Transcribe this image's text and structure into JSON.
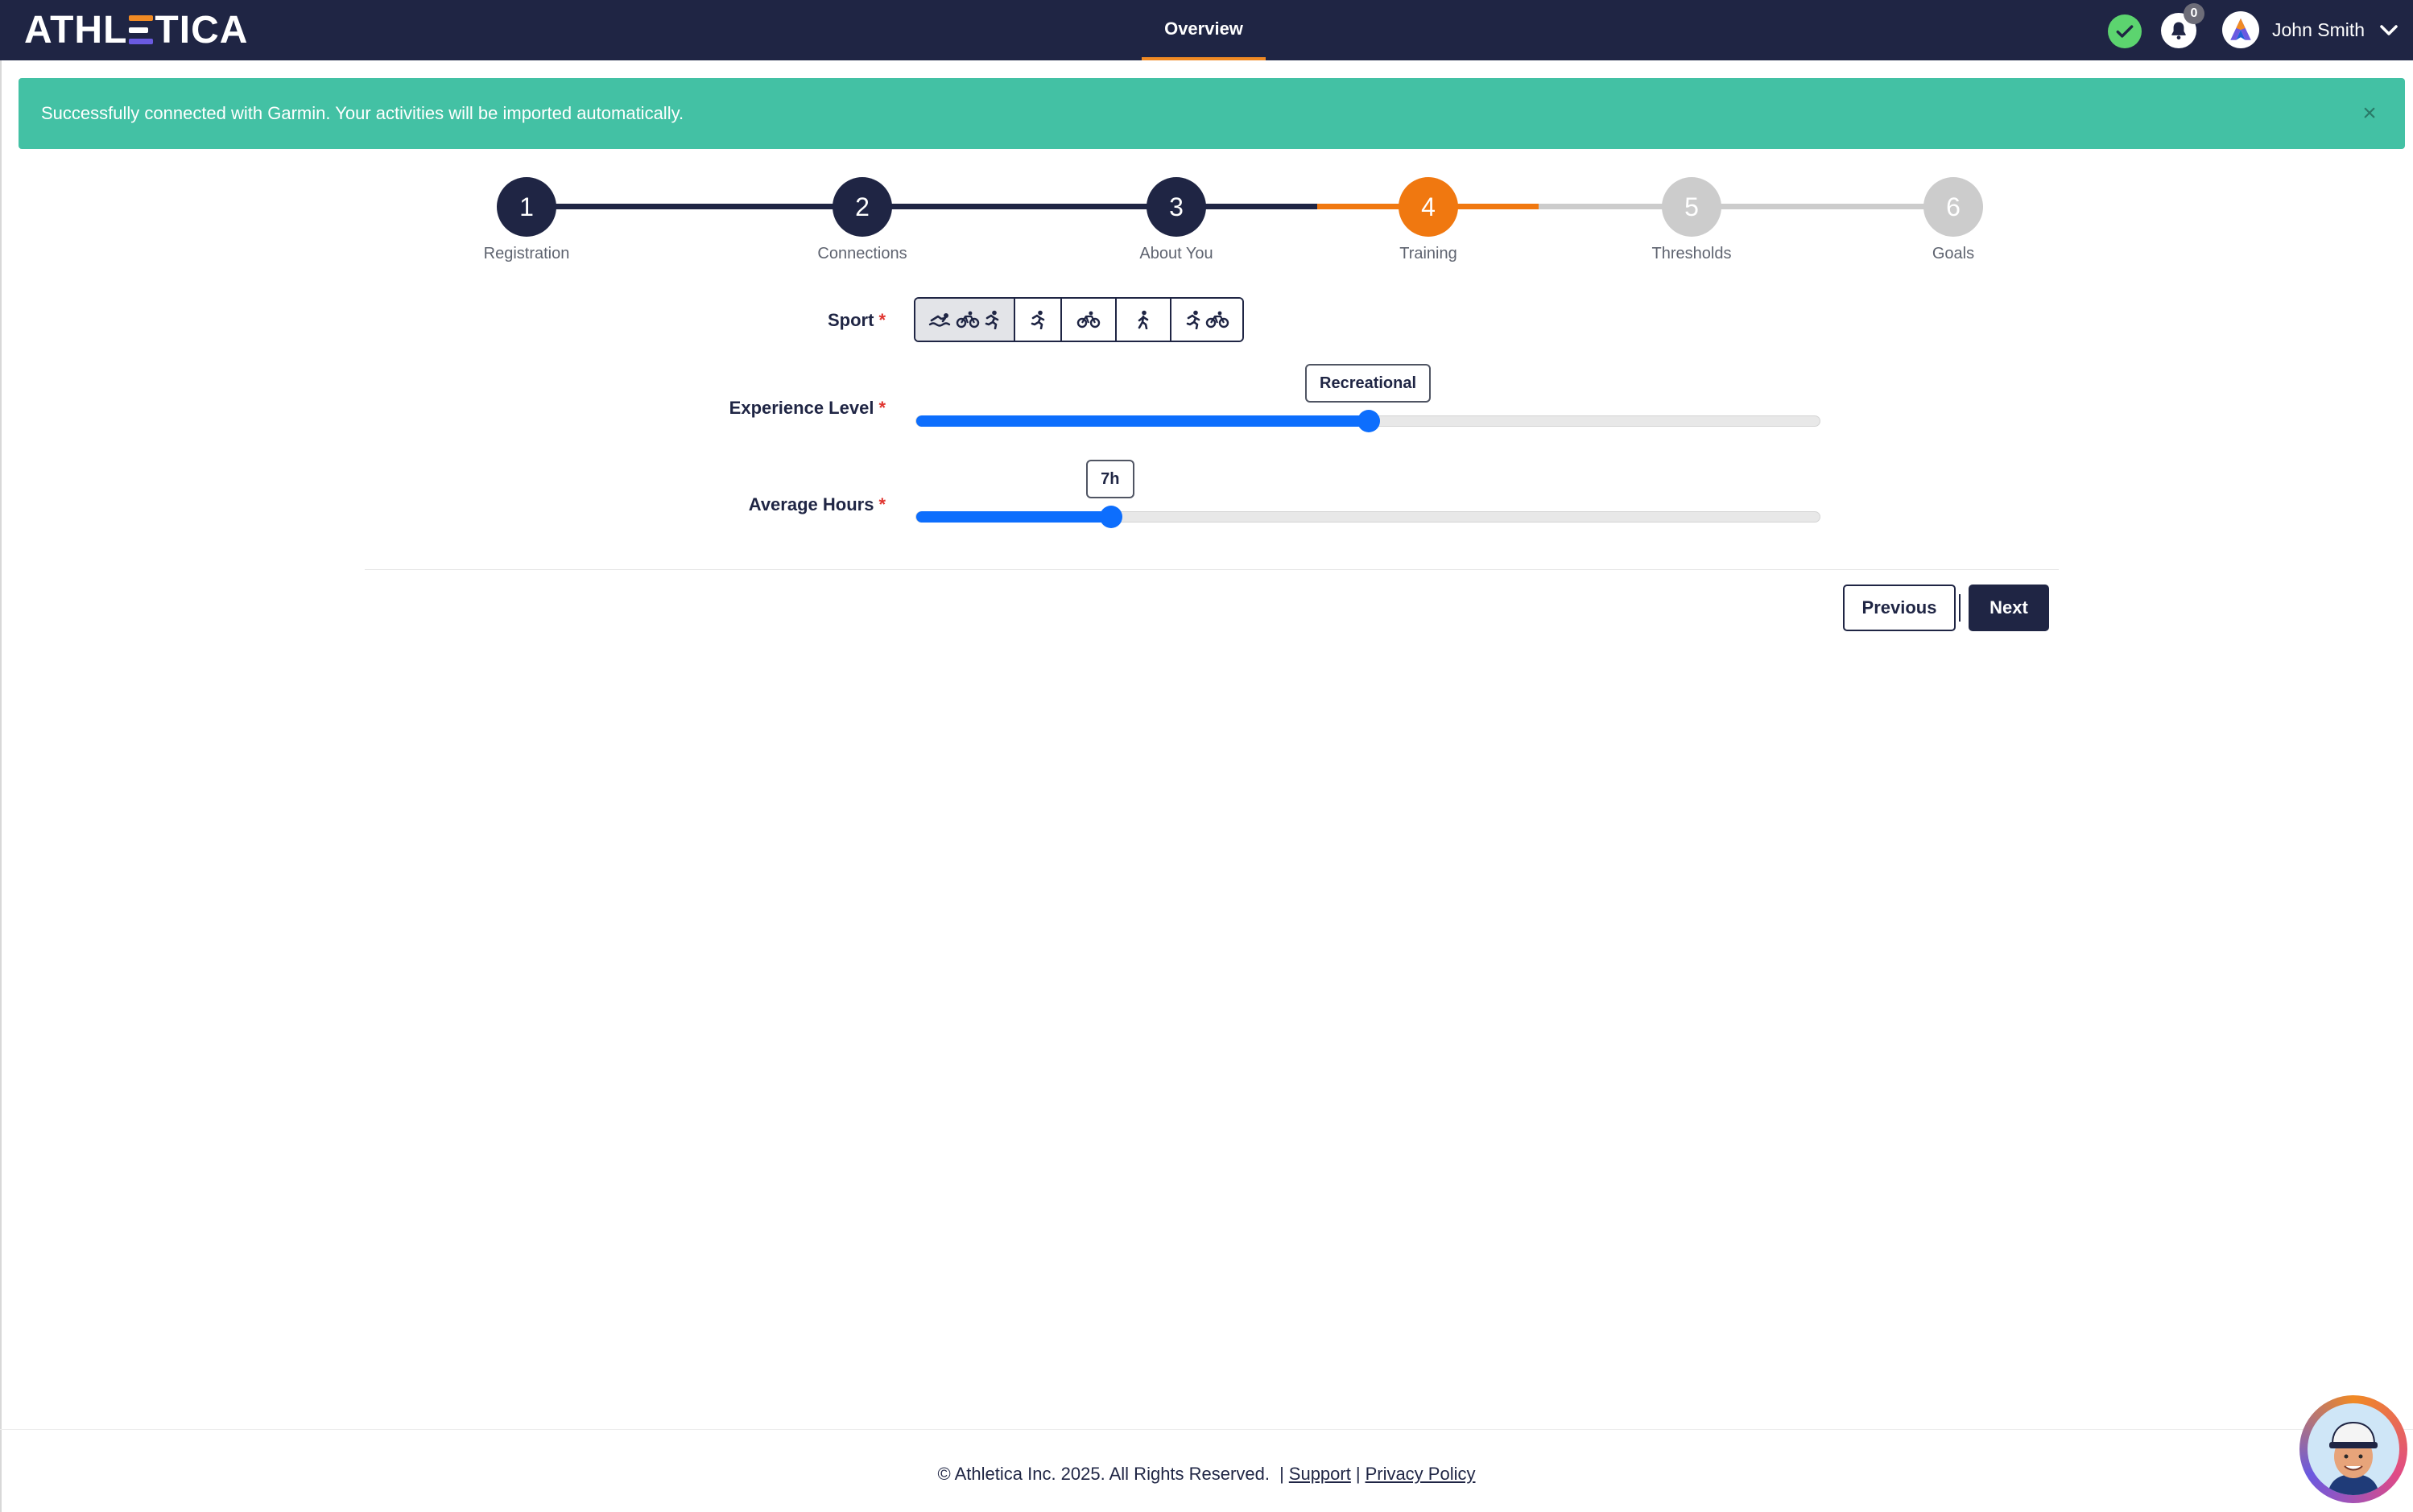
{
  "header": {
    "logo": {
      "left": "ATHL",
      "right": "TICA"
    },
    "nav_tab": "Overview",
    "notifications_count": "0",
    "user_name": "John Smith"
  },
  "alert": {
    "message": "Successfully connected with Garmin. Your activities will be imported automatically.",
    "close": "×"
  },
  "stepper": {
    "current_step": 4,
    "steps": [
      {
        "number": "1",
        "label": "Registration",
        "state": "done"
      },
      {
        "number": "2",
        "label": "Connections",
        "state": "done"
      },
      {
        "number": "3",
        "label": "About You",
        "state": "done"
      },
      {
        "number": "4",
        "label": "Training",
        "state": "active"
      },
      {
        "number": "5",
        "label": "Thresholds",
        "state": "todo"
      },
      {
        "number": "6",
        "label": "Goals",
        "state": "todo"
      }
    ]
  },
  "form": {
    "required_mark": "*",
    "sport": {
      "label": "Sport",
      "options": [
        {
          "icons": [
            "swim-icon",
            "bike-icon",
            "run-icon"
          ],
          "selected": true
        },
        {
          "icons": [
            "run-icon"
          ],
          "selected": false
        },
        {
          "icons": [
            "bike-icon"
          ],
          "selected": false
        },
        {
          "icons": [
            "walk-icon"
          ],
          "selected": false
        },
        {
          "icons": [
            "run-icon",
            "bike-icon"
          ],
          "selected": false
        }
      ]
    },
    "experience": {
      "label": "Experience Level",
      "value_label": "Recreational",
      "level_fraction": 0.5
    },
    "hours": {
      "label": "Average Hours",
      "value_label": "7h",
      "level_fraction": 0.215
    }
  },
  "buttons": {
    "previous": "Previous",
    "next": "Next"
  },
  "footer": {
    "copyright": "© Athletica Inc. 2025. All Rights Reserved.",
    "separator": "|",
    "support": "Support",
    "privacy": "Privacy Policy"
  },
  "colors": {
    "navy": "#1f2544",
    "accent_orange": "#f07810",
    "success_teal": "#43c1a4",
    "slider_blue": "#0d6efd",
    "step_todo": "#cccccc"
  }
}
